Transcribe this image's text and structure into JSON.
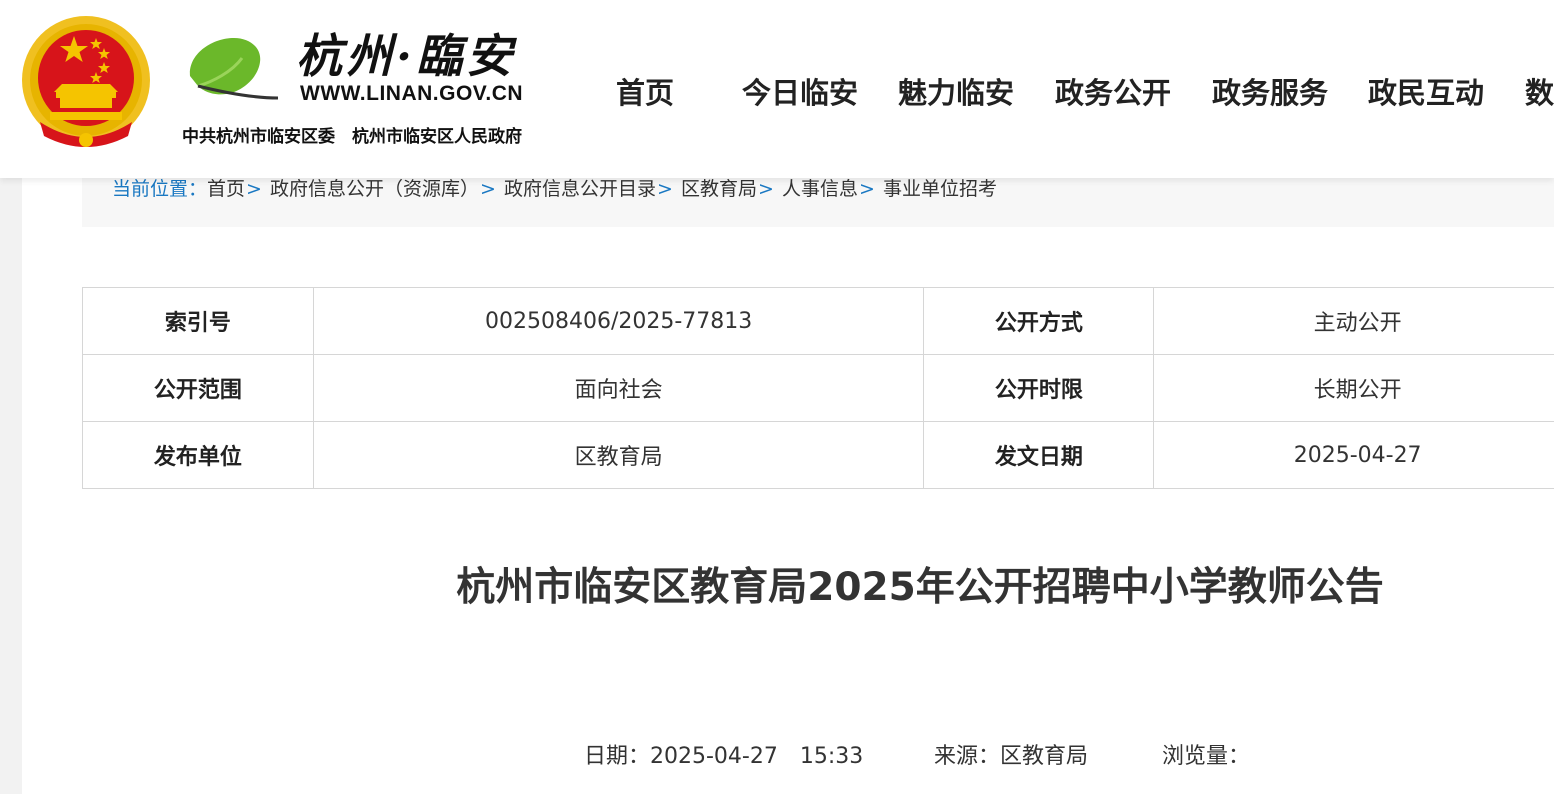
{
  "header": {
    "site_title": "杭州·臨安",
    "site_url": "WWW.LINAN.GOV.CN",
    "org_line": "中共杭州市临安区委　杭州市临安区人民政府",
    "nav": [
      "首页",
      "今日临安",
      "魅力临安",
      "政务公开",
      "政务服务",
      "政民互动",
      "数"
    ],
    "icons": {
      "emblem": "national-emblem-icon",
      "ginkgo": "ginkgo-leaf-logo"
    },
    "colors": {
      "emblem_red": "#d7141a",
      "emblem_gold": "#f5c400",
      "leaf_green": "#6bb82a"
    }
  },
  "breadcrumb": {
    "label": "当前位置：",
    "sep": ">",
    "items": [
      "首页",
      "政府信息公开（资源库）",
      "政府信息公开目录",
      "区教育局",
      "人事信息",
      "事业单位招考"
    ]
  },
  "meta_table": {
    "rows": [
      {
        "k1": "索引号",
        "v1": "002508406/2025-77813",
        "k2": "公开方式",
        "v2": "主动公开"
      },
      {
        "k1": "公开范围",
        "v1": "面向社会",
        "k2": "公开时限",
        "v2": "长期公开"
      },
      {
        "k1": "发布单位",
        "v1": "区教育局",
        "k2": "发文日期",
        "v2": "2025-04-27"
      }
    ]
  },
  "article": {
    "title": "杭州市临安区教育局2025年公开招聘中小学教师公告",
    "date": "日期：2025-04-27　15:33",
    "source": "来源：区教育局",
    "views": "浏览量："
  },
  "colors": {
    "breadcrumb_accent": "#1a78c2",
    "breadcrumb_bg": "#f7f7f7",
    "table_border": "#d6d6d6"
  }
}
